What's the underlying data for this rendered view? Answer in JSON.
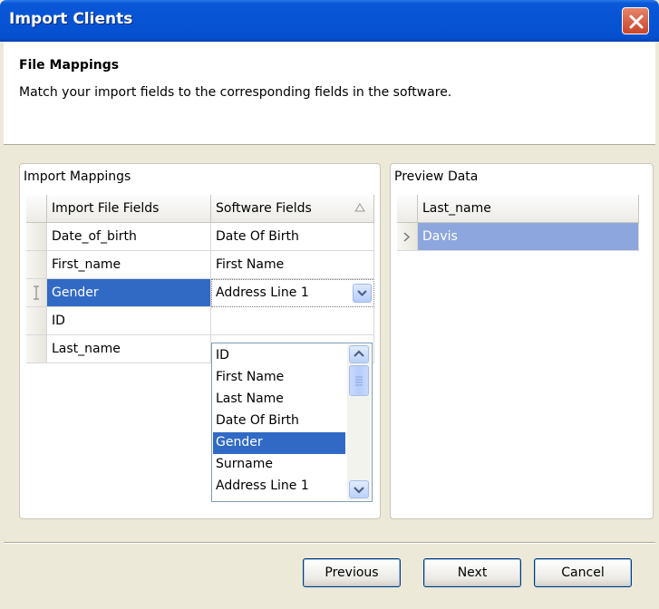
{
  "window": {
    "title": "Import Clients"
  },
  "header": {
    "title": "File Mappings",
    "description": "Match your import fields to the corresponding fields in the software."
  },
  "import_mappings": {
    "title": "Import Mappings",
    "columns": [
      "Import File Fields",
      "Software Fields"
    ],
    "rows": [
      {
        "import_field": "Date_of_birth",
        "software_field": "Date Of Birth"
      },
      {
        "import_field": "First_name",
        "software_field": "First Name"
      },
      {
        "import_field": "Gender",
        "software_field": "Address Line 1",
        "selected": true
      },
      {
        "import_field": "ID",
        "software_field": ""
      },
      {
        "import_field": "Last_name",
        "software_field": ""
      }
    ],
    "dropdown_options": [
      "ID",
      "First Name",
      "Last Name",
      "Date Of Birth",
      "Gender",
      "Surname",
      "Address Line 1"
    ],
    "dropdown_highlighted": "Gender"
  },
  "preview": {
    "title": "Preview Data",
    "columns": [
      "Last_name"
    ],
    "rows": [
      "Davis"
    ]
  },
  "buttons": {
    "previous": "Previous",
    "next": "Next",
    "cancel": "Cancel"
  },
  "colors": {
    "titlebar": "#0654d4",
    "selection": "#316ac5",
    "preview_selection": "#8da6de"
  },
  "icons": {
    "close": "close-icon",
    "sort": "sort-ascending-icon",
    "row_pointer": "row-pointer-icon",
    "combo": "chevron-down-icon"
  }
}
